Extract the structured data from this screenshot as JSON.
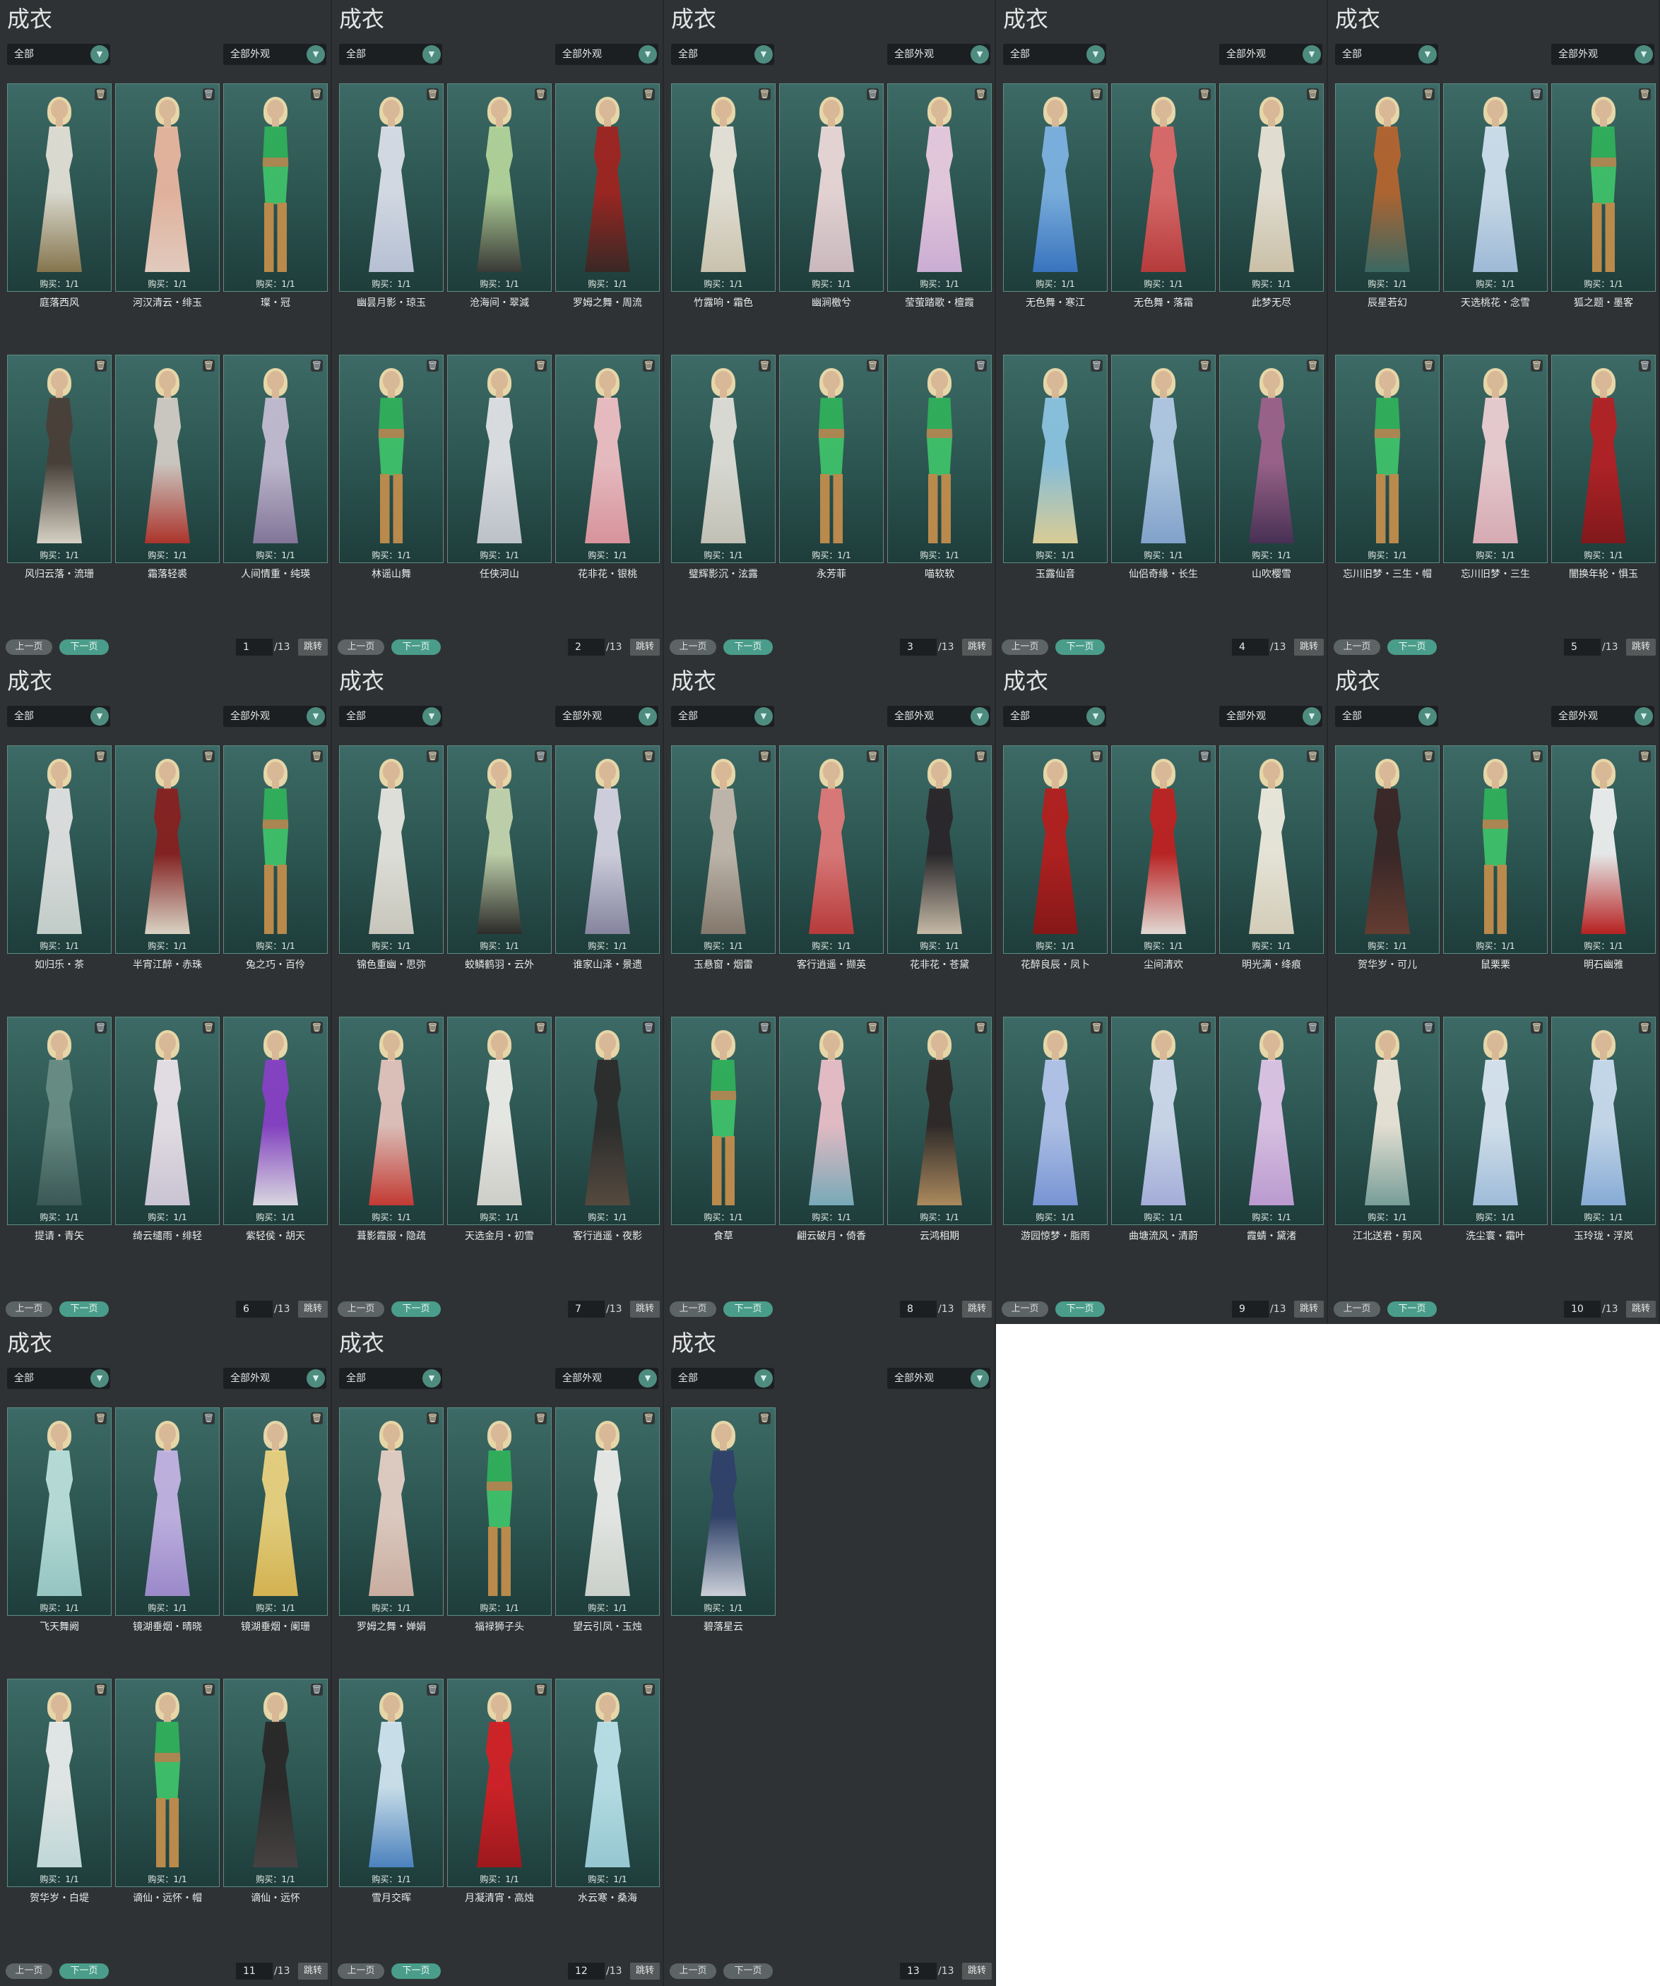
{
  "labels": {
    "title": "成衣",
    "filter1": "全部",
    "filter2": "全部外观",
    "prev": "上一页",
    "next": "下一页",
    "jump": "跳转",
    "total": "/13",
    "price": "购买：1/1",
    "trash_icon": "trash-icon",
    "chevron_icon": "chevron-down-icon"
  },
  "colors": {
    "panel_bg": "#2e3234",
    "card_bg": "#2b5450",
    "accent": "#4a9d8a"
  },
  "pages": [
    {
      "page": "1",
      "items": [
        "庭落西风",
        "河汉清云・绯玉",
        "璨・冠",
        "风归云落・流珊",
        "霜落轻裘",
        "人间情重・纯瑛"
      ]
    },
    {
      "page": "2",
      "items": [
        "幽昙月影・琼玉",
        "沧海间・翠減",
        "罗姆之舞・周流",
        "林谣山舞",
        "任侠河山",
        "花非花・银桃"
      ]
    },
    {
      "page": "3",
      "items": [
        "竹露响・霜色",
        "幽涧檄兮",
        "莹萤踏歌・檀霞",
        "璧辉影沉・泫露",
        "永芳菲",
        "喵软软"
      ]
    },
    {
      "page": "4",
      "items": [
        "无色舞・寒江",
        "无色舞・落霜",
        "此梦无尽",
        "玉露仙音",
        "仙侣奇缘・长生",
        "山吹樱雪"
      ]
    },
    {
      "page": "5",
      "items": [
        "辰星若幻",
        "天选桃花・念雪",
        "狐之题・墨客",
        "忘川旧梦・三生・帽",
        "忘川旧梦・三生",
        "闇换年轮・惧玉"
      ]
    },
    {
      "page": "6",
      "items": [
        "如归乐・茶",
        "半宵江醉・赤珠",
        "兔之巧・百伶",
        "提请・青矢",
        "绮云缱雨・绯轻",
        "紫轻侯・胡天"
      ]
    },
    {
      "page": "7",
      "items": [
        "锦色重幽・思弥",
        "蛟鳞鹤羽・云外",
        "谁家山泽・景遗",
        "葺影霞服・隐疏",
        "天选金月・初雪",
        "客行逍遥・夜影"
      ]
    },
    {
      "page": "8",
      "items": [
        "玉悬窗・烟雷",
        "客行逍遥・撷英",
        "花非花・苍黛",
        "食草",
        "翩云破月・倚香",
        "云鸿相期"
      ]
    },
    {
      "page": "9",
      "items": [
        "花醉良辰・凤卜",
        "尘间清欢",
        "明光满・绛痕",
        "游园惊梦・脂雨",
        "曲塘流风・清蔚",
        "霞蜻・黛渚"
      ]
    },
    {
      "page": "10",
      "items": [
        "贺华岁・可儿",
        "鼠栗栗",
        "明石幽雅",
        "江北送君・剪风",
        "洗尘寰・霜叶",
        "玉玲珑・浮岚"
      ]
    },
    {
      "page": "11",
      "items": [
        "飞天舞阙",
        "镜湖垂烟・晴晓",
        "镜湖垂烟・阑珊",
        "贺华岁・白堤",
        "谪仙・远怀・帽",
        "谪仙・远怀"
      ]
    },
    {
      "page": "12",
      "items": [
        "罗姆之舞・婵娟",
        "福禄狮子头",
        "望云引凤・玉烛",
        "雪月交晖",
        "月凝清宵・高烛",
        "水云寒・桑海"
      ]
    },
    {
      "page": "13",
      "items": [
        "碧落星云"
      ]
    }
  ]
}
